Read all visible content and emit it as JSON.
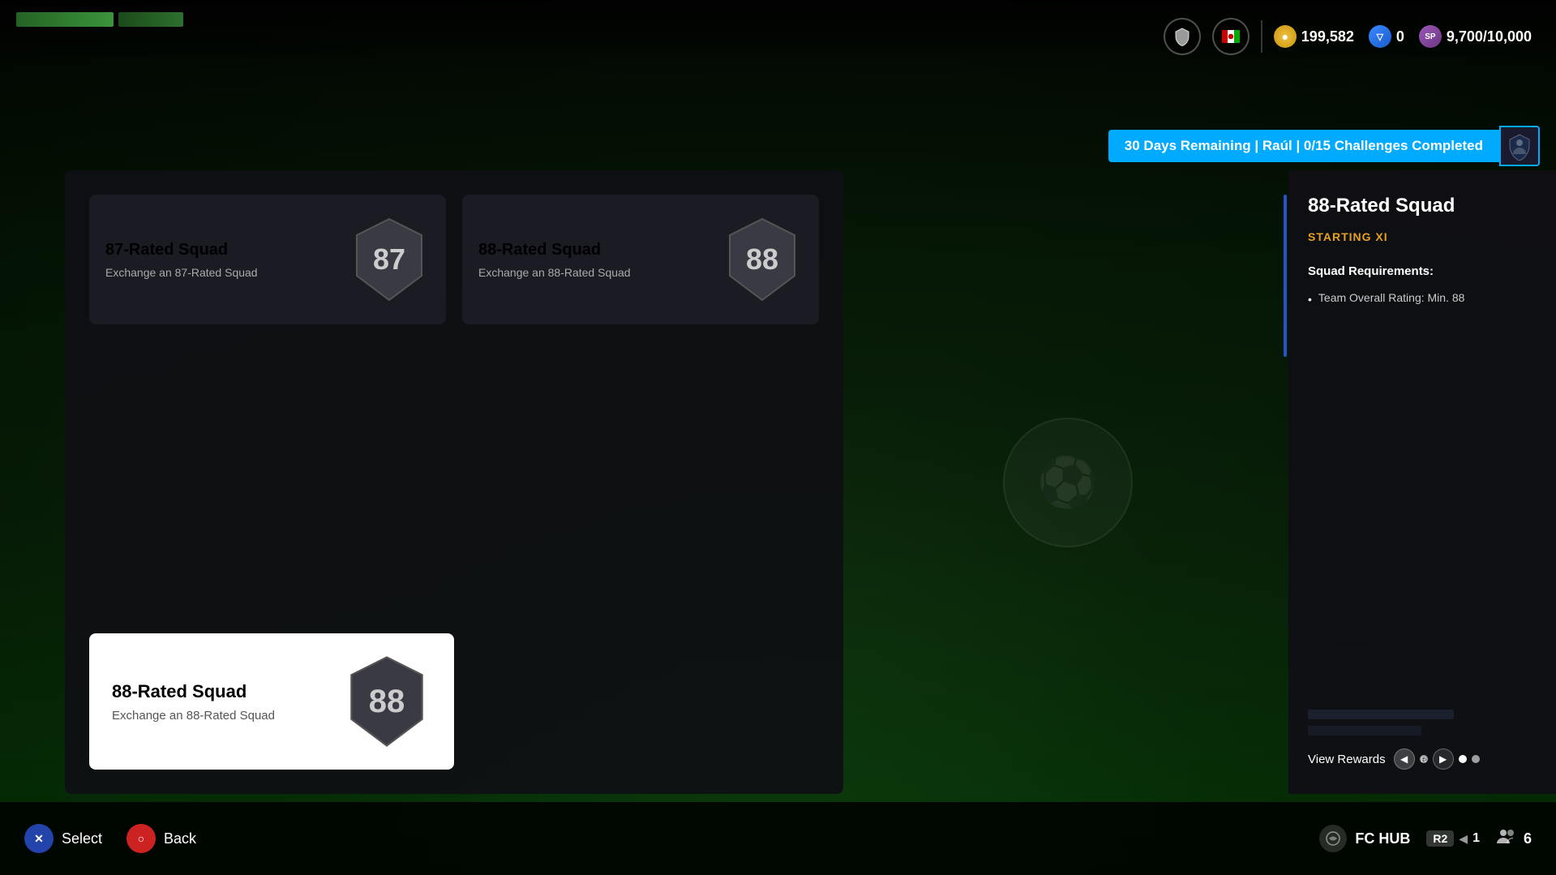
{
  "background": {
    "color_main": "#0d1f0d",
    "color_overlay": "rgba(0,0,0,0.7)"
  },
  "top_bar": {
    "icon1": "shield-icon",
    "icon2": "flag-icon",
    "currency": {
      "coins_label": "199,582",
      "coins_icon": "coin-icon",
      "points_label": "0",
      "points_icon": "v-icon",
      "sp_label": "9,700/10,000",
      "sp_icon": "sp-icon"
    }
  },
  "challenge_banner": {
    "text": "30 Days Remaining | Raúl | 0/15 Challenges Completed"
  },
  "main_panel": {
    "cards": [
      {
        "id": "card-87",
        "title": "87-Rated Squad",
        "subtitle": "Exchange an 87-Rated Squad",
        "rating": "87",
        "selected": false
      },
      {
        "id": "card-88-top",
        "title": "88-Rated Squad",
        "subtitle": "Exchange an 88-Rated Squad",
        "rating": "88",
        "selected": false
      }
    ],
    "selected_card": {
      "title": "88-Rated Squad",
      "subtitle": "Exchange an 88-Rated Squad",
      "rating": "88"
    }
  },
  "detail_panel": {
    "title": "88-Rated Squad",
    "subtitle": "STARTING XI",
    "section_title": "Squad Requirements:",
    "requirements": [
      "Team Overall Rating: Min. 88"
    ],
    "view_rewards_label": "View Rewards"
  },
  "bottom_bar": {
    "select_label": "Select",
    "back_label": "Back",
    "fc_hub_label": "FC HUB",
    "r2_label": "R2",
    "count_r2": "1",
    "count_users": "6"
  }
}
